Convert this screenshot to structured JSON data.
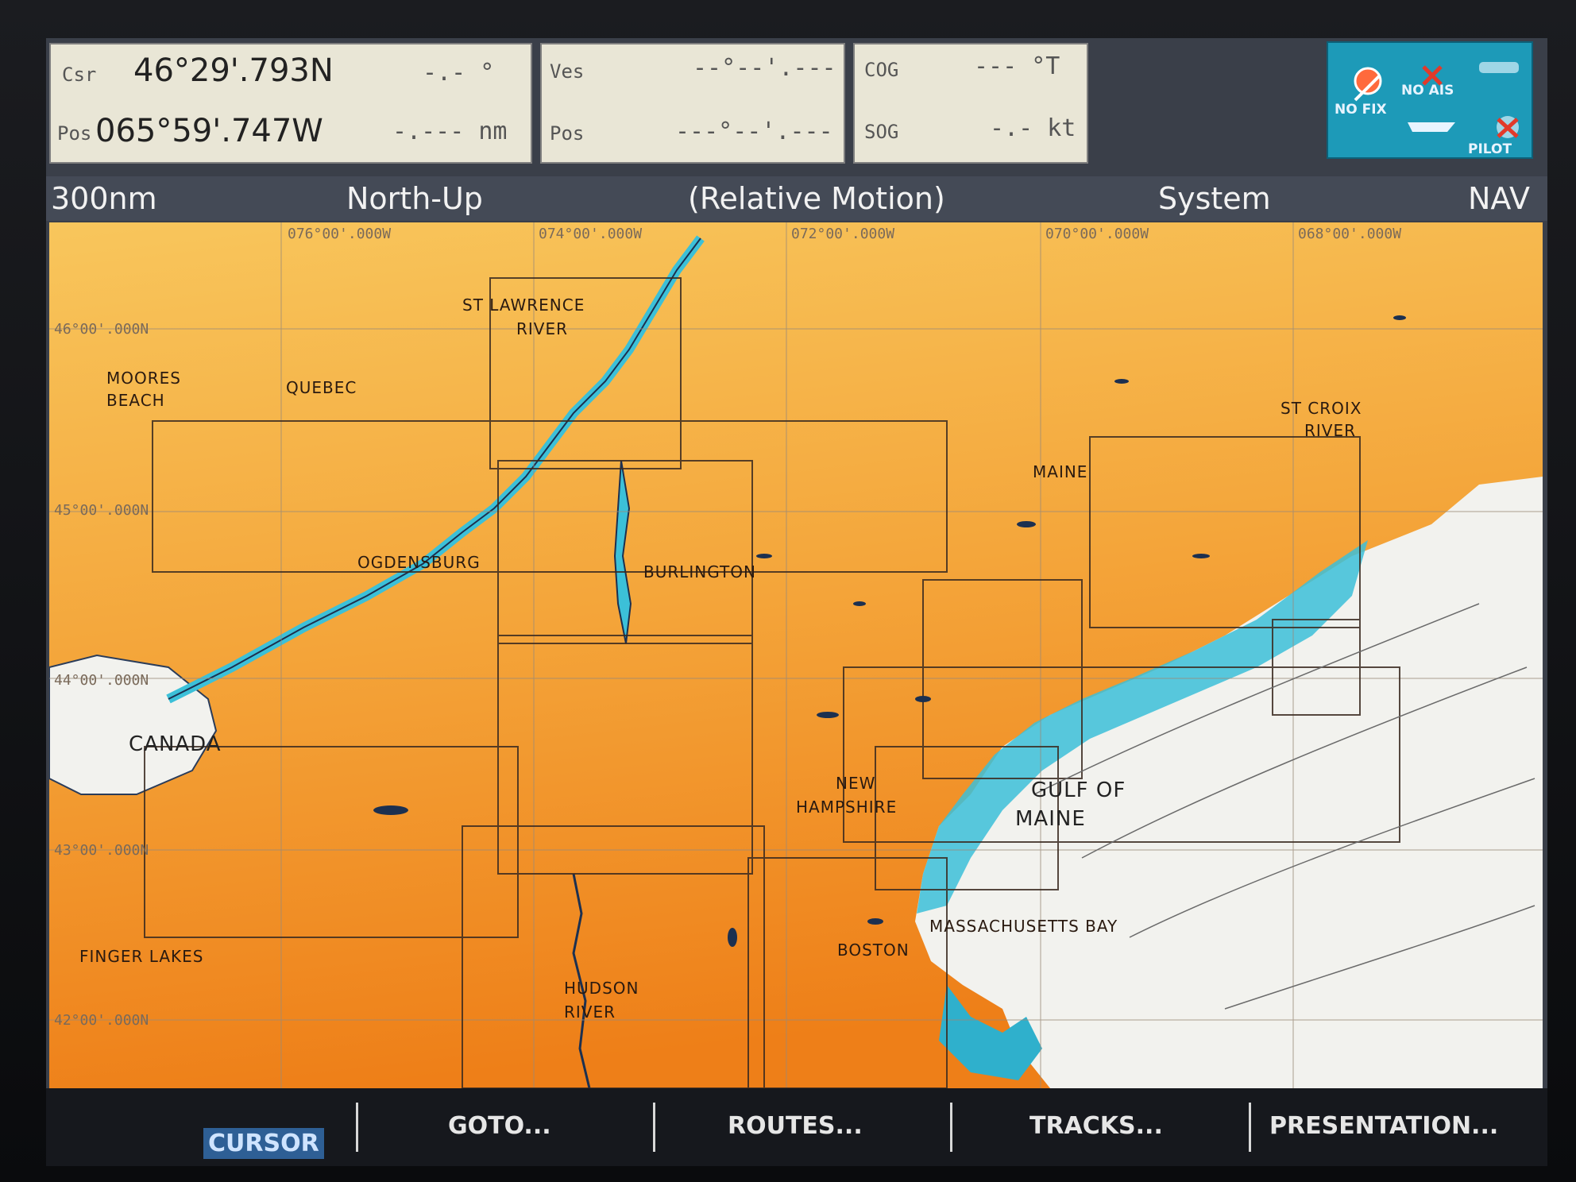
{
  "data_panel": {
    "cursor": {
      "label": "Csr",
      "lat": "46°29'.793N",
      "bearing": "-.- °"
    },
    "position": {
      "label": "Pos",
      "lon": "065°59'.747W",
      "range": "-.--- nm"
    },
    "vessel": {
      "label": "Ves",
      "lat": "--°--'.---",
      "pos_label": "Pos",
      "lon": "---°--'.---"
    },
    "cog": {
      "label": "COG",
      "value": "--- °T"
    },
    "sog": {
      "label": "SOG",
      "value": "-.- kt"
    }
  },
  "status": {
    "no_fix": "NO FIX",
    "no_ais": "NO AIS",
    "pilot": "PILOT"
  },
  "header": {
    "range": "300nm",
    "orientation": "North-Up",
    "motion": "(Relative Motion)",
    "mode": "System",
    "nav": "NAV"
  },
  "map": {
    "longitudes": [
      "076°00'.000W",
      "074°00'.000W",
      "072°00'.000W",
      "070°00'.000W",
      "068°00'.000W"
    ],
    "latitudes": [
      "46°00'.000N",
      "45°00'.000N",
      "44°00'.000N",
      "43°00'.000N",
      "42°00'.000N"
    ],
    "places": {
      "st_lawrence_1": "ST LAWRENCE",
      "st_lawrence_2": "RIVER",
      "moores_1": "MOORES",
      "moores_2": "BEACH",
      "quebec": "QUEBEC",
      "ogdensburg": "OGDENSBURG",
      "burlington": "BURLINGTON",
      "canada": "CANADA",
      "maine": "MAINE",
      "st_croix_1": "ST CROIX",
      "st_croix_2": "RIVER",
      "new_hampshire_1": "NEW",
      "new_hampshire_2": "HAMPSHIRE",
      "gulf_1": "GULF OF",
      "gulf_2": "MAINE",
      "finger_lakes": "FINGER LAKES",
      "boston": "BOSTON",
      "massachusetts_bay": "MASSACHUSETTS BAY",
      "hudson_1": "HUDSON",
      "hudson_2": "RIVER"
    },
    "colors": {
      "land_light": "#f6c15a",
      "land_dark": "#f08a1e",
      "shallow": "#3cc0d8",
      "sea": "#f2f2ee"
    }
  },
  "softkeys": {
    "cursor": "CURSOR",
    "goto": "GOTO...",
    "routes": "ROUTES...",
    "tracks": "TRACKS...",
    "presentation": "PRESENTATION..."
  }
}
